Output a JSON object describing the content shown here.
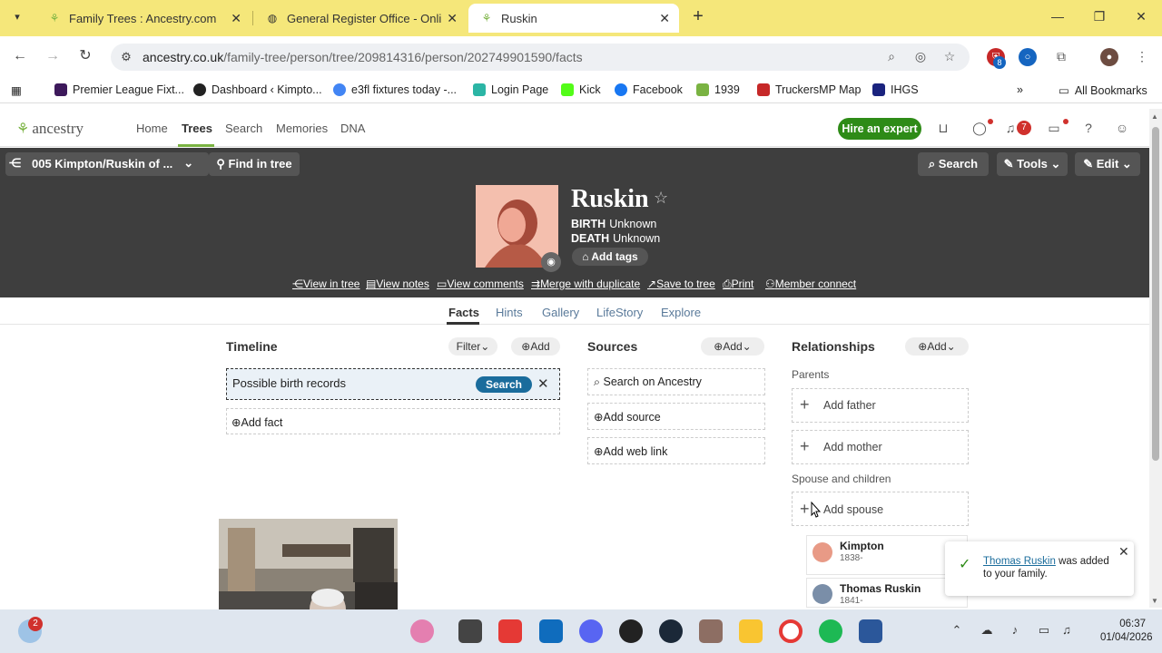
{
  "browser": {
    "tabs": [
      {
        "label": "Family Trees : Ancestry.com",
        "icon": "ancestry-leaf-icon"
      },
      {
        "label": "General Register Office - Online",
        "icon": "globe-icon"
      },
      {
        "label": "Ruskin",
        "icon": "ancestry-leaf-icon"
      }
    ],
    "url_host": "ancestry.co.uk",
    "url_path": "/family-tree/person/tree/209814316/person/202749901590/facts",
    "extension_badge": "8",
    "bookmarks": [
      {
        "label": "Premier League Fixt...",
        "color": "#3d195b"
      },
      {
        "label": "Dashboard ‹ Kimpto...",
        "color": "#222222"
      },
      {
        "label": "e3fl fixtures today -...",
        "color": "#4285f4"
      },
      {
        "label": "Login Page",
        "color": "#2bb5a5"
      },
      {
        "label": "Kick",
        "color": "#53fc18"
      },
      {
        "label": "Facebook",
        "color": "#1877f2"
      },
      {
        "label": "1939",
        "color": "#7ab342"
      },
      {
        "label": "TruckersMP Map",
        "color": "#c62828"
      },
      {
        "label": "IHGS",
        "color": "#1a237e"
      }
    ],
    "all_bookmarks": "All Bookmarks"
  },
  "ancestry": {
    "logo": "ancestry",
    "nav": [
      "Home",
      "Trees",
      "Search",
      "Memories",
      "DNA"
    ],
    "hire_expert": "Hire an expert",
    "notifications_count": "7",
    "brand_green": "#2e8b17"
  },
  "person_header": {
    "tree_name": "005 Kimpton/Ruskin of ...",
    "find_in_tree": "Find in tree",
    "search": "Search",
    "tools": "Tools",
    "edit": "Edit",
    "name": "Ruskin",
    "birth_label": "BIRTH",
    "birth_value": "Unknown",
    "death_label": "DEATH",
    "death_value": "Unknown",
    "add_tags": "Add tags",
    "actions": [
      "View in tree",
      "View notes",
      "View comments",
      "Merge with duplicate",
      "Save to tree",
      "Print",
      "Member connect"
    ]
  },
  "subtabs": [
    "Facts",
    "Hints",
    "Gallery",
    "LifeStory",
    "Explore"
  ],
  "timeline": {
    "title": "Timeline",
    "filter": "Filter",
    "add": "Add",
    "possible_birth": "Possible birth records",
    "search_btn": "Search",
    "add_fact": "Add fact"
  },
  "sources": {
    "title": "Sources",
    "add": "Add",
    "items": [
      "Search on Ancestry",
      "Add source",
      "Add web link"
    ]
  },
  "relationships": {
    "title": "Relationships",
    "add": "Add",
    "parents_label": "Parents",
    "add_father": "Add father",
    "add_mother": "Add mother",
    "spouse_label": "Spouse and children",
    "add_spouse": "Add spouse",
    "children": [
      {
        "name": "Kimpton",
        "dates": "1838-"
      },
      {
        "name": "Thomas Ruskin",
        "dates": "1841-"
      }
    ]
  },
  "toast": {
    "link": "Thomas Ruskin",
    "message": " was added to your family."
  },
  "taskbar": {
    "badge": "2",
    "time": "06:37",
    "date": "01/04/2026"
  }
}
